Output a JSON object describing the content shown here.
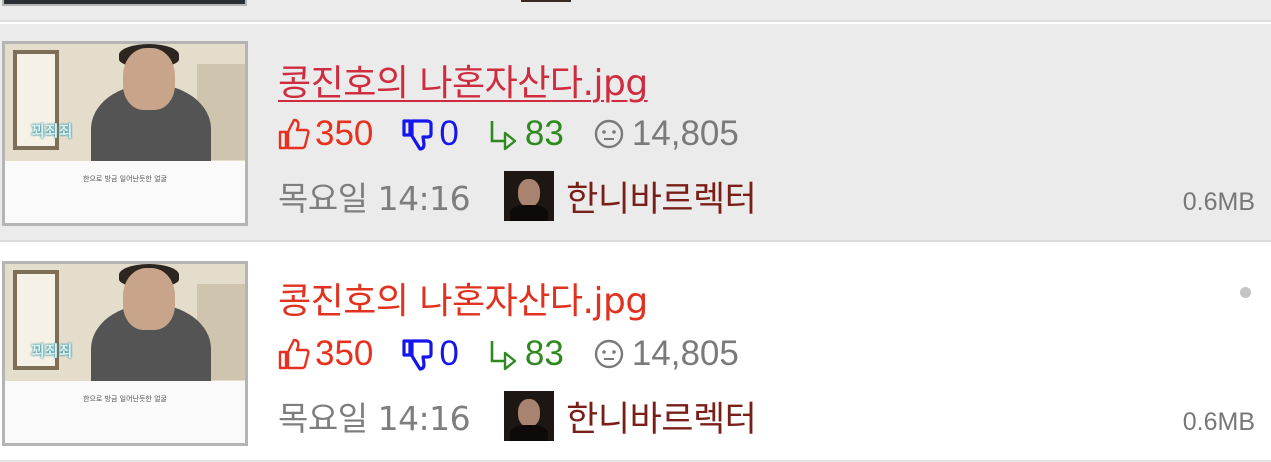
{
  "posts": [
    {
      "title": "콩진호의 나혼자산다.jpg",
      "visited": true,
      "thumbnail": {
        "overlay_text": "꾀죄죄",
        "subtitle": "한으로 방금 일어난듯한 얼굴"
      },
      "likes": "350",
      "dislikes": "0",
      "replies": "83",
      "views": "14,805",
      "date": "목요일 14:16",
      "author": "한니바르렉터",
      "size": "0.6MB"
    },
    {
      "title": "콩진호의 나혼자산다.jpg",
      "visited": false,
      "thumbnail": {
        "overlay_text": "꾀죄죄",
        "subtitle": "한으로 방금 일어난듯한 얼굴"
      },
      "likes": "350",
      "dislikes": "0",
      "replies": "83",
      "views": "14,805",
      "date": "목요일 14:16",
      "author": "한니바르렉터",
      "size": "0.6MB"
    }
  ],
  "icons": {
    "like": "thumbs-up-icon",
    "dislike": "thumbs-down-icon",
    "reply": "reply-arrow-icon",
    "views": "eye-face-icon",
    "new": "dot-indicator-icon"
  },
  "colors": {
    "title_visited": "#d02c3f",
    "title": "#e0321f",
    "like": "#e8301e",
    "dislike": "#1515ee",
    "reply": "#2e8a1f",
    "meta": "#7e7e7e",
    "author": "#7a1f17",
    "row_visited_bg": "#ebebeb"
  }
}
